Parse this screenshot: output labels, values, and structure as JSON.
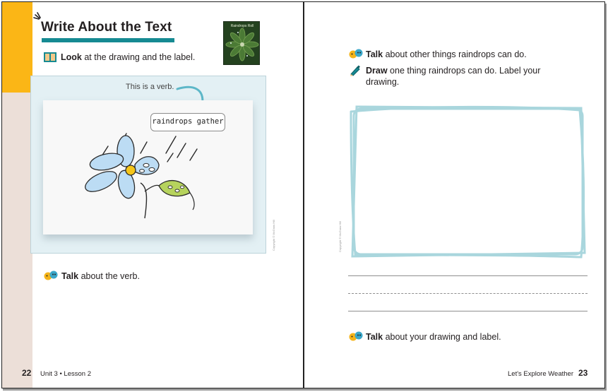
{
  "left_page": {
    "title": "Write About the Text",
    "book_cover_title": "Raindrops Roll",
    "look_instruction": {
      "bold": "Look",
      "text": " at the drawing and the label."
    },
    "verb_note": "This is a verb.",
    "drawing_label": "raindrops gather",
    "talk_prompt": {
      "bold": "Talk",
      "text": " about the verb."
    },
    "copyright": "Copyright © McGraw Hill",
    "footer": {
      "page_number": "22",
      "unit_lesson": "Unit 3 • Lesson 2"
    }
  },
  "right_page": {
    "talk_prompt_1": {
      "bold": "Talk",
      "text": " about other things raindrops can do."
    },
    "draw_prompt": {
      "bold": "Draw",
      "text_line1": " one thing raindrops can do. Label your",
      "text_line2": "drawing."
    },
    "talk_prompt_2": {
      "bold": "Talk",
      "text": " about your drawing and label."
    },
    "copyright": "Copyright © McGraw Hill",
    "footer": {
      "page_number": "23",
      "book_title": "Let's Explore Weather"
    }
  },
  "icons": {
    "talk_icon": "talk-partners-icon",
    "look_icon": "book-icon",
    "draw_icon": "pencil-icon",
    "title_accent": "spark-lines-icon"
  },
  "colors": {
    "gold": "#fbb616",
    "teal_bar": "#168a92",
    "margin": "#ecdfd8",
    "drawing_frame": "#a9d6dd",
    "flower_petal": "#bcdcf4"
  }
}
